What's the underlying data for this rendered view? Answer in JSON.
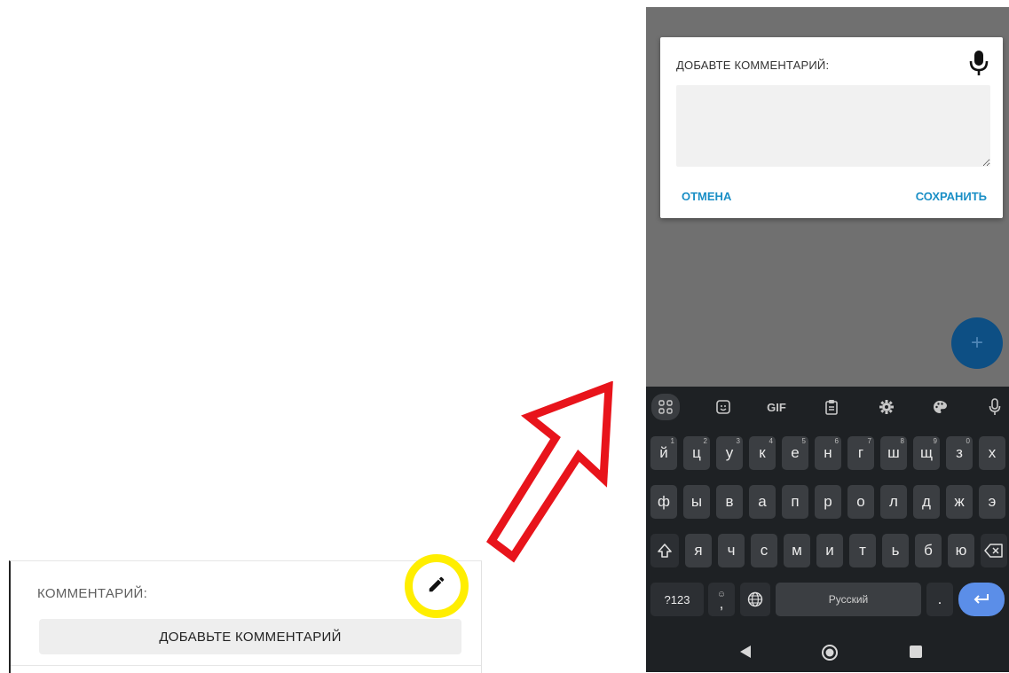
{
  "left_card": {
    "label": "КОММЕНТАРИЙ:",
    "add_button": "ДОБАВЬТЕ КОММЕНТАРИЙ",
    "edit_icon": "pencil-icon",
    "highlight_color": "#ffee00"
  },
  "arrow": {
    "color": "#e8141b"
  },
  "dialog": {
    "title": "ДОБАВТЕ КОММЕНТАРИЙ:",
    "mic_icon": "microphone-icon",
    "comment_value": "",
    "cancel_label": "ОТМЕНА",
    "save_label": "СОХРАНИТЬ",
    "accent_color": "#1a8fc6"
  },
  "fab": {
    "label": "+",
    "icon": "plus-icon"
  },
  "keyboard": {
    "toolbar": [
      {
        "name": "apps-grid-icon",
        "label": ""
      },
      {
        "name": "sticker-icon",
        "label": ""
      },
      {
        "name": "gif-button",
        "label": "GIF"
      },
      {
        "name": "clipboard-icon",
        "label": ""
      },
      {
        "name": "settings-icon",
        "label": ""
      },
      {
        "name": "theme-palette-icon",
        "label": ""
      },
      {
        "name": "voice-input-icon",
        "label": ""
      }
    ],
    "row1": [
      {
        "k": "й",
        "h": "1"
      },
      {
        "k": "ц",
        "h": "2"
      },
      {
        "k": "у",
        "h": "3"
      },
      {
        "k": "к",
        "h": "4"
      },
      {
        "k": "е",
        "h": "5"
      },
      {
        "k": "н",
        "h": "6"
      },
      {
        "k": "г",
        "h": "7"
      },
      {
        "k": "ш",
        "h": "8"
      },
      {
        "k": "щ",
        "h": "9"
      },
      {
        "k": "з",
        "h": "0"
      },
      {
        "k": "х",
        "h": ""
      }
    ],
    "row2": [
      "ф",
      "ы",
      "в",
      "а",
      "п",
      "р",
      "о",
      "л",
      "д",
      "ж",
      "э"
    ],
    "row3": [
      "я",
      "ч",
      "с",
      "м",
      "и",
      "т",
      "ь",
      "б",
      "ю"
    ],
    "shift_icon": "shift-icon",
    "backspace_icon": "backspace-icon",
    "symbols_label": "?123",
    "emoji_comma": ",",
    "globe_icon": "globe-icon",
    "space_label": "Русский",
    "period_label": ".",
    "enter_icon": "enter-icon"
  },
  "navbar": {
    "back_icon": "back-triangle-icon",
    "home_icon": "home-circle-icon",
    "recents_icon": "recents-square-icon"
  }
}
